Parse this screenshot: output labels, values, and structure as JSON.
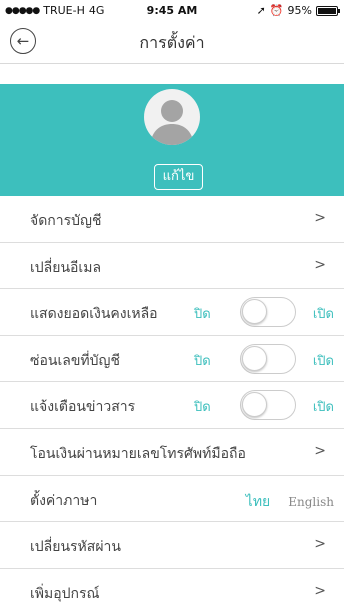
{
  "status_bar": {
    "carrier": "TRUE-H",
    "network": "4G",
    "time": "9:45 AM",
    "battery": "95%",
    "battery_level": 0.95
  },
  "nav": {
    "title": "การตั้งค่า"
  },
  "profile": {
    "edit_label": "แก้ไข"
  },
  "chevron": ">",
  "toggle_off": "ปิด",
  "toggle_on": "เปิด",
  "list": [
    {
      "label": "จัดการบัญชี"
    },
    {
      "label": "เปลี่ยนอีเมล"
    },
    {
      "label": "แสดงยอดเงินคงเหลือ",
      "checked": false
    },
    {
      "label": "ซ่อนเลขที่บัญชี",
      "checked": false
    },
    {
      "label": "แจ้งเตือนข่าวสาร",
      "checked": false
    },
    {
      "label": "โอนเงินผ่านหมายเลขโทรศัพท์มือถือ"
    },
    {
      "label": "ตั้งค่าภาษา",
      "lang_thai": "ไทย",
      "lang_english": "English"
    },
    {
      "label": "เปลี่ยนรหัสผ่าน"
    },
    {
      "label": "เพิ่มอุปกรณ์"
    }
  ],
  "colors": {
    "accent": "#3dbfbd"
  }
}
